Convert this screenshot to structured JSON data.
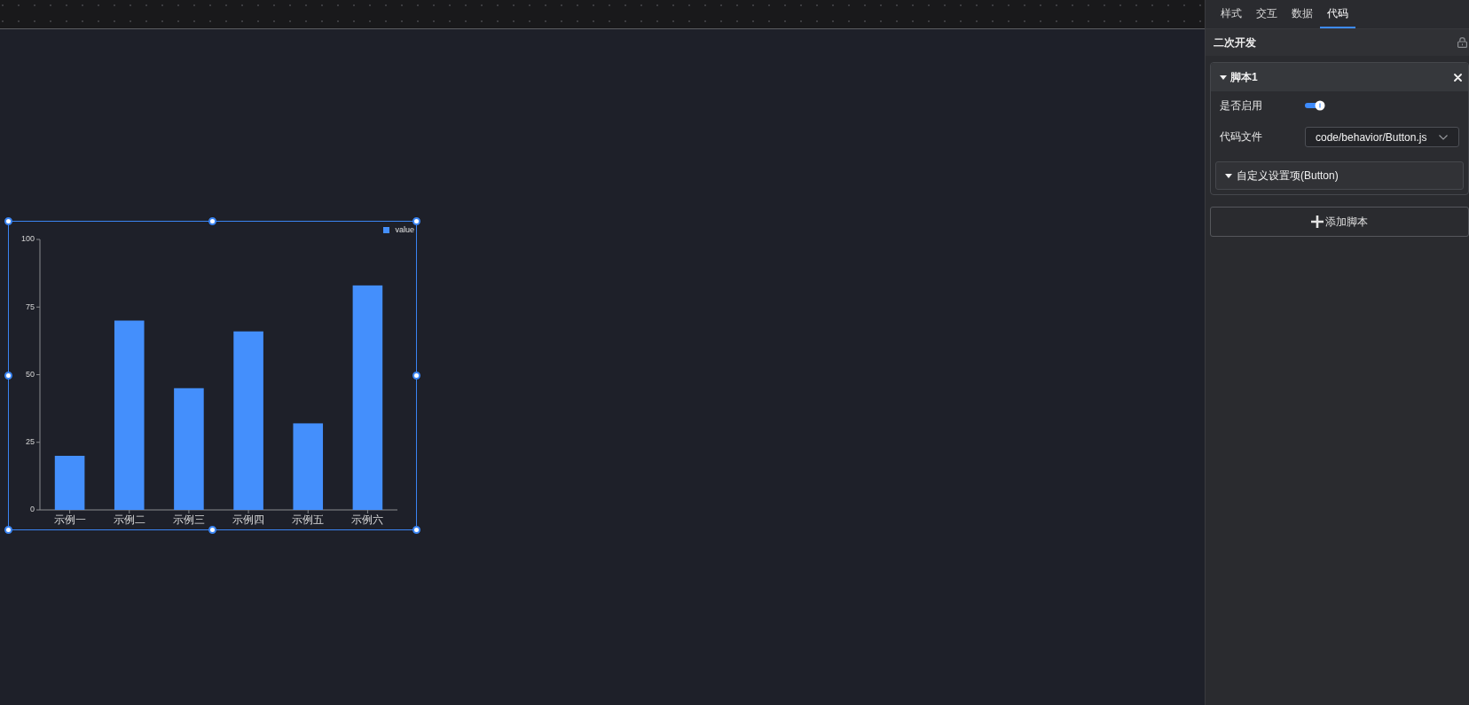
{
  "canvas": {
    "widget": {
      "selected": true,
      "chart_data": {
        "type": "bar",
        "categories": [
          "示例一",
          "示例二",
          "示例三",
          "示例四",
          "示例五",
          "示例六"
        ],
        "series": [
          {
            "name": "value",
            "color": "#448ffc",
            "values": [
              20,
              70,
              45,
              66,
              32,
              83
            ]
          }
        ],
        "ylim": [
          0,
          100
        ],
        "yticks": [
          0,
          25,
          50,
          75,
          100
        ]
      }
    }
  },
  "panel": {
    "tabs": [
      {
        "label": "样式",
        "selected": false
      },
      {
        "label": "交互",
        "selected": false
      },
      {
        "label": "数据",
        "selected": false
      },
      {
        "label": "代码",
        "selected": true
      }
    ],
    "section": {
      "title": "二次开发"
    },
    "scripts": [
      {
        "title": "脚本1",
        "expanded": true,
        "fields": [
          {
            "kind": "toggle",
            "label": "是否启用",
            "on": true
          },
          {
            "kind": "select",
            "label": "代码文件",
            "value": "code/behavior/Button.js"
          }
        ],
        "subsection": {
          "title": "自定义设置项(Button)",
          "expanded": true
        }
      }
    ],
    "add_button": {
      "label": "添加脚本"
    }
  }
}
